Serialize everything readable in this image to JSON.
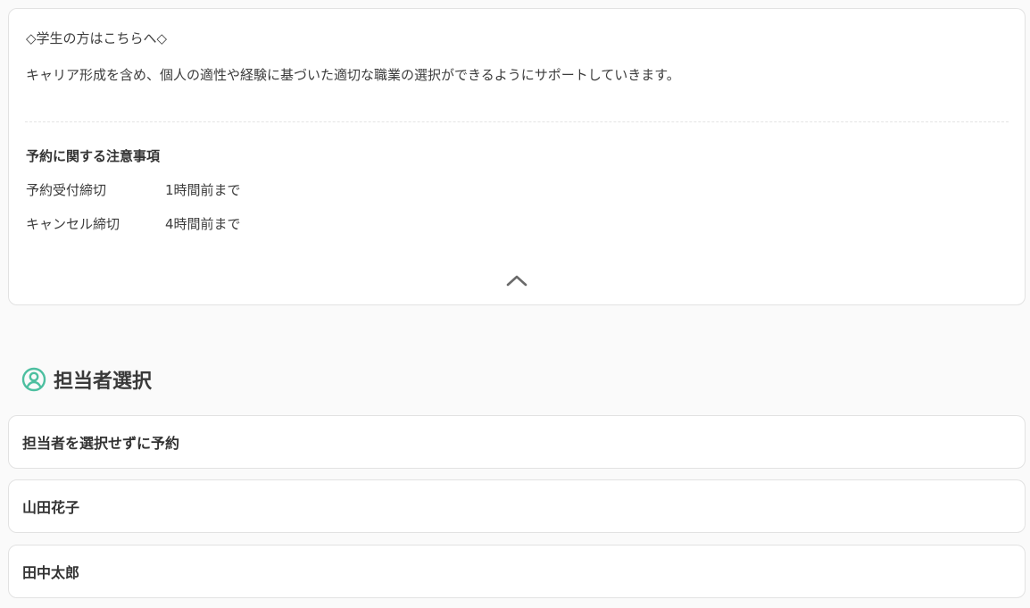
{
  "info_card": {
    "student_note": "◇学生の方はこちらへ◇",
    "description": "キャリア形成を含め、個人の適性や経験に基づいた適切な職業の選択ができるようにサポートしていきます。",
    "notice_heading": "予約に関する注意事項",
    "notices": [
      {
        "label": "予約受付締切",
        "value": "1時間前まで"
      },
      {
        "label": "キャンセル締切",
        "value": "4時間前まで"
      }
    ],
    "collapse_icon": "chevron-up-icon"
  },
  "staff_section": {
    "icon": "user-circle-icon",
    "accent_color": "#4dbfa0",
    "title": "担当者選択",
    "options": [
      {
        "label": "担当者を選択せずに予約"
      },
      {
        "label": "山田花子"
      },
      {
        "label": "田中太郎"
      }
    ]
  }
}
